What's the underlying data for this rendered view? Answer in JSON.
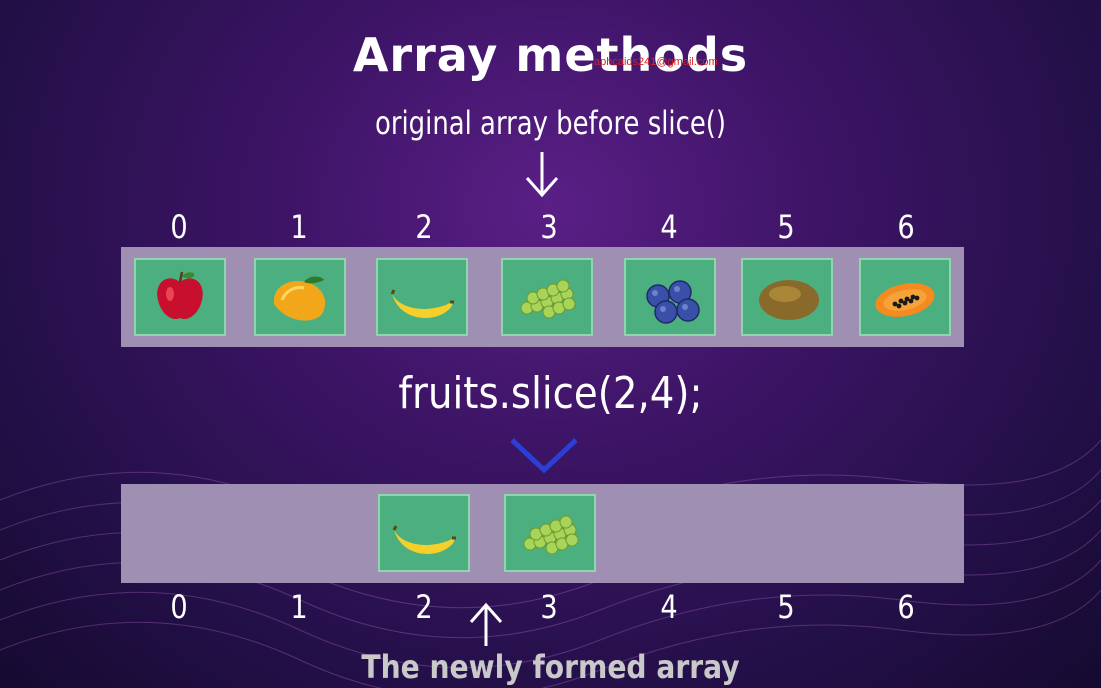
{
  "title": "Array methods",
  "watermark": "aphcaids241@gmail.com",
  "subtitle": "original array before slice()",
  "top_indices": [
    "0",
    "1",
    "2",
    "3",
    "4",
    "5",
    "6"
  ],
  "original_array": [
    {
      "fruit": "apple",
      "icon": "apple-icon"
    },
    {
      "fruit": "mango",
      "icon": "mango-icon"
    },
    {
      "fruit": "banana",
      "icon": "banana-icon"
    },
    {
      "fruit": "grapes",
      "icon": "grapes-icon"
    },
    {
      "fruit": "blueberries",
      "icon": "blueberries-icon"
    },
    {
      "fruit": "kiwi",
      "icon": "kiwi-icon"
    },
    {
      "fruit": "papaya",
      "icon": "papaya-icon"
    }
  ],
  "code": "fruits.slice(2,4);",
  "sliced_array": [
    {
      "fruit": "banana",
      "icon": "banana-icon"
    },
    {
      "fruit": "grapes",
      "icon": "grapes-icon"
    }
  ],
  "bottom_indices": [
    "0",
    "1",
    "2",
    "3",
    "4",
    "5",
    "6"
  ],
  "caption": "The newly formed array",
  "colors": {
    "cell": "#4caf80",
    "bar": "#9e8fb3",
    "chevron": "#2a3fd6"
  }
}
